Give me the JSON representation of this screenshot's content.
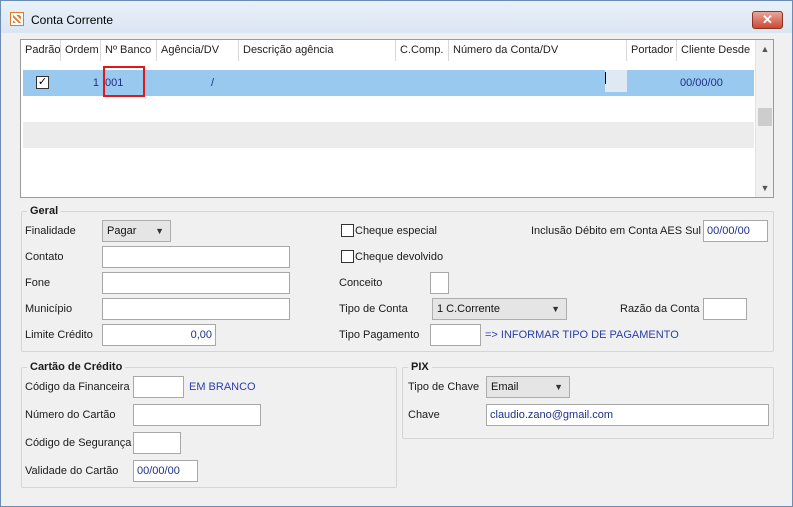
{
  "window": {
    "title": "Conta Corrente",
    "close_label": "✕"
  },
  "grid": {
    "columns": [
      "Padrão",
      "Ordem",
      "Nº Banco",
      "Agência/DV",
      "Descrição agência",
      "C.Comp.",
      "Número da Conta/DV",
      "Portador",
      "Cliente Desde"
    ],
    "row": {
      "padrao_checked": true,
      "ordem": "1",
      "banco": "001",
      "agencia": "/",
      "cliente_desde": "00/00/00"
    }
  },
  "geral": {
    "title": "Geral",
    "finalidade_label": "Finalidade",
    "finalidade_value": "Pagar",
    "contato_label": "Contato",
    "fone_label": "Fone",
    "municipio_label": "Município",
    "limite_label": "Limite Crédito",
    "limite_value": "0,00",
    "cheque_especial_label": "Cheque especial",
    "cheque_devolvido_label": "Cheque devolvido",
    "conceito_label": "Conceito",
    "tipo_conta_label": "Tipo de Conta",
    "tipo_conta_value": "1 C.Corrente",
    "tipo_pagamento_label": "Tipo Pagamento",
    "tipo_pagamento_hint": "=> INFORMAR TIPO DE PAGAMENTO",
    "inclusao_label": "Inclusão Débito em Conta AES Sul",
    "inclusao_value": "00/00/00",
    "razao_label": "Razão da Conta"
  },
  "cartao": {
    "title": "Cartão de Crédito",
    "financeira_label": "Código da Financeira",
    "financeira_hint": "EM BRANCO",
    "numero_label": "Número do Cartão",
    "seguranca_label": "Código de Segurança",
    "validade_label": "Validade do Cartão",
    "validade_value": "00/00/00"
  },
  "pix": {
    "title": "PIX",
    "tipo_label": "Tipo de Chave",
    "tipo_value": "Email",
    "chave_label": "Chave",
    "chave_value": "claudio.zano@gmail.com"
  },
  "icons": {
    "scroll_up": "chevron-up-icon",
    "scroll_down": "chevron-down-icon",
    "dropdown": "chevron-down-icon",
    "check": "check-icon"
  },
  "colors": {
    "selection": "#99c9ef",
    "value_text": "#1f2f8a",
    "highlight": "#e01818"
  }
}
